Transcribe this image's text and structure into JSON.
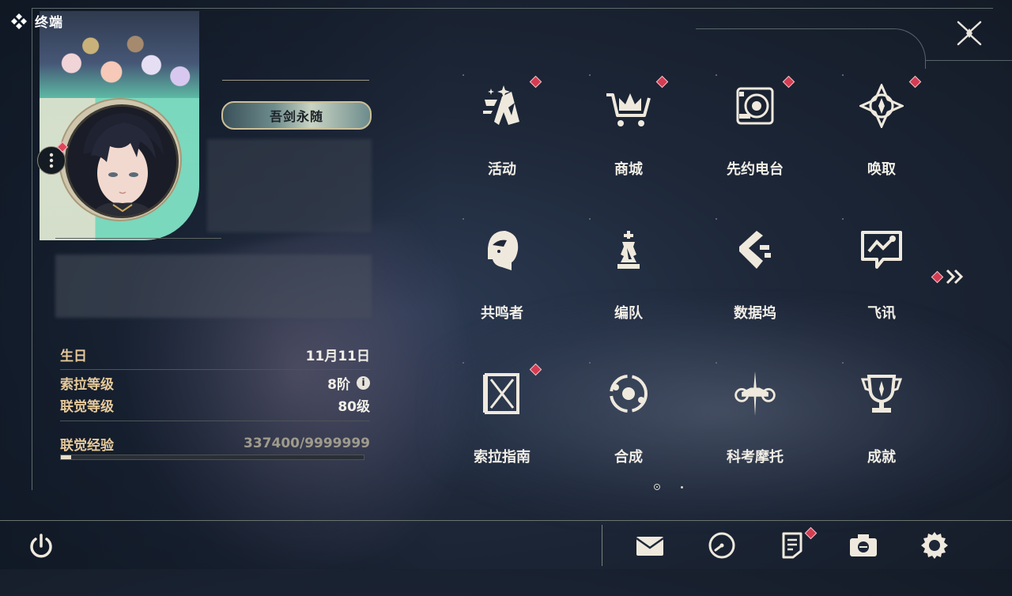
{
  "header": {
    "title": "终端"
  },
  "profile": {
    "title_badge": "吾剑永随",
    "stats": {
      "birthday_label": "生日",
      "birthday_value": "11月11日",
      "sola_level_label": "索拉等级",
      "sola_level_value": "8阶",
      "union_level_label": "联觉等级",
      "union_level_value": "80级",
      "union_exp_label": "联觉经验",
      "union_exp_value": "337400/9999999",
      "union_exp_fraction": 0.0337
    }
  },
  "menu": {
    "items": [
      {
        "label": "活动",
        "icon": "activity-icon",
        "badge": true
      },
      {
        "label": "商城",
        "icon": "shop-cart-icon",
        "badge": true
      },
      {
        "label": "先约电台",
        "icon": "radio-icon",
        "badge": true
      },
      {
        "label": "唤取",
        "icon": "convene-icon",
        "badge": true
      },
      {
        "label": "共鸣者",
        "icon": "resonator-icon",
        "badge": false
      },
      {
        "label": "编队",
        "icon": "team-chess-icon",
        "badge": false
      },
      {
        "label": "数据坞",
        "icon": "data-bank-icon",
        "badge": false
      },
      {
        "label": "飞讯",
        "icon": "message-icon",
        "badge": false
      },
      {
        "label": "索拉指南",
        "icon": "guidebook-icon",
        "badge": true
      },
      {
        "label": "合成",
        "icon": "synthesis-icon",
        "badge": false
      },
      {
        "label": "科考摩托",
        "icon": "motorbike-icon",
        "badge": false
      },
      {
        "label": "成就",
        "icon": "trophy-icon",
        "badge": false
      }
    ],
    "page_current": 1,
    "page_total": 2
  },
  "bottom_bar": {
    "icons": [
      "power-icon",
      "mail-icon",
      "clock-icon",
      "notice-icon",
      "camera-icon",
      "settings-gear-icon"
    ]
  },
  "colors": {
    "badge": "#d43c52",
    "label_gold": "#e6c99a",
    "card_teal": "#66d8ba"
  }
}
